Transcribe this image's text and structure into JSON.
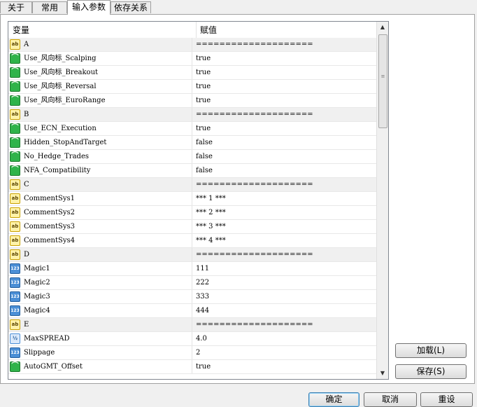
{
  "tabs": [
    "关于",
    "常用",
    "输入参数",
    "依存关系"
  ],
  "table": {
    "headers": {
      "name": "变量",
      "value": "赋值"
    },
    "rows": [
      {
        "icon": "string",
        "name": "A",
        "value": "====================",
        "section": true
      },
      {
        "icon": "bool",
        "name": "Use_风向标_Scalping",
        "value": "true"
      },
      {
        "icon": "bool",
        "name": "Use_风向标_Breakout",
        "value": "true"
      },
      {
        "icon": "bool",
        "name": "Use_风向标_Reversal",
        "value": "true"
      },
      {
        "icon": "bool",
        "name": "Use_风向标_EuroRange",
        "value": "true"
      },
      {
        "icon": "string",
        "name": "B",
        "value": "====================",
        "section": true
      },
      {
        "icon": "bool",
        "name": "Use_ECN_Execution",
        "value": "true"
      },
      {
        "icon": "bool",
        "name": "Hidden_StopAndTarget",
        "value": "false"
      },
      {
        "icon": "bool",
        "name": "No_Hedge_Trades",
        "value": "false"
      },
      {
        "icon": "bool",
        "name": "NFA_Compatibility",
        "value": "false"
      },
      {
        "icon": "string",
        "name": "C",
        "value": "====================",
        "section": true
      },
      {
        "icon": "string",
        "name": "CommentSys1",
        "value": "*** 1 ***"
      },
      {
        "icon": "string",
        "name": "CommentSys2",
        "value": "*** 2 ***"
      },
      {
        "icon": "string",
        "name": "CommentSys3",
        "value": "*** 3 ***"
      },
      {
        "icon": "string",
        "name": "CommentSys4",
        "value": "*** 4 ***"
      },
      {
        "icon": "string",
        "name": "D",
        "value": "====================",
        "section": true
      },
      {
        "icon": "int",
        "name": "Magic1",
        "value": "111"
      },
      {
        "icon": "int",
        "name": "Magic2",
        "value": "222"
      },
      {
        "icon": "int",
        "name": "Magic3",
        "value": "333"
      },
      {
        "icon": "int",
        "name": "Magic4",
        "value": "444"
      },
      {
        "icon": "string",
        "name": "E",
        "value": "====================",
        "section": true
      },
      {
        "icon": "double",
        "name": "MaxSPREAD",
        "value": "4.0"
      },
      {
        "icon": "int",
        "name": "Slippage",
        "value": "2"
      },
      {
        "icon": "bool",
        "name": "AutoGMT_Offset",
        "value": "true"
      }
    ]
  },
  "icons": {
    "string": {
      "glyph": "ab",
      "class": "ab"
    },
    "bool": {
      "glyph": "⌒",
      "class": "bool"
    },
    "int": {
      "glyph": "123",
      "class": "int"
    },
    "double": {
      "glyph": "½",
      "class": "dbl"
    }
  },
  "side_buttons": {
    "load": "加载(L)",
    "save": "保存(S)"
  },
  "footer_buttons": {
    "ok": "确定",
    "cancel": "取消",
    "reset": "重设"
  },
  "scrollbar": {
    "up": "▲",
    "down": "▼",
    "grip": "≡"
  }
}
